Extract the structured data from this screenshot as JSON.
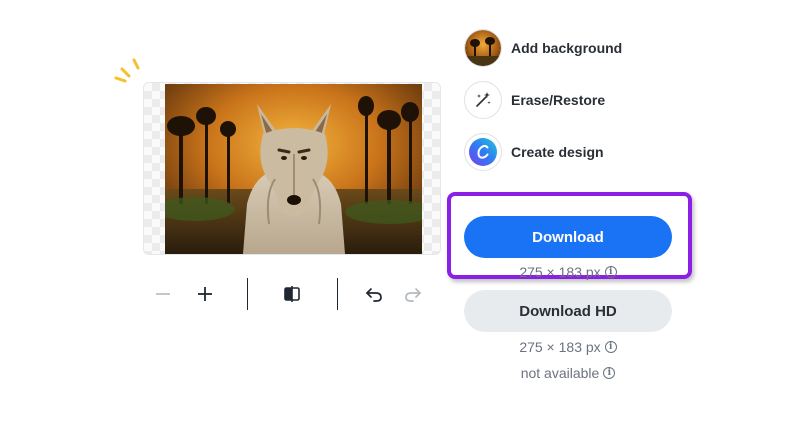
{
  "side_actions": [
    {
      "label": "Add background",
      "icon": "background-thumbnail-icon"
    },
    {
      "label": "Erase/Restore",
      "icon": "magic-wand-icon"
    },
    {
      "label": "Create design",
      "icon": "canva-logo-icon"
    }
  ],
  "download": {
    "label": "Download",
    "size": "275 × 183 px",
    "accent": "#1a73f5",
    "highlight_color": "#8a1fe6"
  },
  "download_hd": {
    "label": "Download HD",
    "size": "275 × 183 px",
    "availability": "not available"
  },
  "toolbar": {
    "icons": [
      "zoom-out-icon",
      "zoom-in-icon",
      "compare-icon",
      "undo-icon",
      "redo-icon"
    ]
  },
  "image": {
    "subject": "coyote-photo"
  }
}
